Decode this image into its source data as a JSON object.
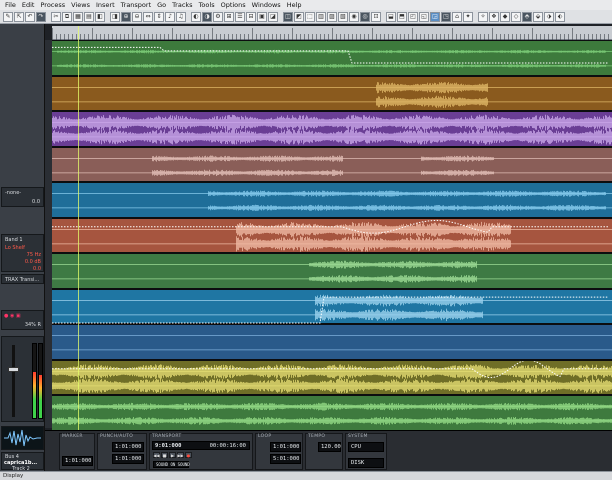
{
  "menu": {
    "items": [
      "File",
      "Edit",
      "Process",
      "Views",
      "Insert",
      "Transport",
      "Go",
      "Tracks",
      "Tools",
      "Options",
      "Windows",
      "Help"
    ]
  },
  "inspector": {
    "top_dropdown": "-none-",
    "top_value": "0.0",
    "band_label": "Band 1",
    "shelf_label": "Lo Shelf",
    "eq_freq": "75 Hz",
    "eq_gain": "0.0 dB",
    "eq_q": "0.0",
    "trans_label": "TRAX Transi...",
    "pan_value": "34% R",
    "bus_label": "Bus 4",
    "track_name": "caprica1b...",
    "track_number": "Track 2"
  },
  "tracks": [
    {
      "color": "#3d7a3c",
      "wave": "#7fd17c"
    },
    {
      "color": "#8a5a1e",
      "wave": "#e7bf6d"
    },
    {
      "color": "#6a3e95",
      "wave": "#d3b1f2"
    },
    {
      "color": "#8a5e58",
      "wave": "#e9c7bf"
    },
    {
      "color": "#1f6e99",
      "wave": "#8fd3f4"
    },
    {
      "color": "#a6553f",
      "wave": "#f7c4ae"
    },
    {
      "color": "#3e7a44",
      "wave": "#a5e39c"
    },
    {
      "color": "#1f76a3",
      "wave": "#a7dcf5"
    },
    {
      "color": "#2a5a8a",
      "wave": "#86b7e3"
    },
    {
      "color": "#6f6e27",
      "wave": "#eee77a"
    },
    {
      "color": "#3e7a3e",
      "wave": "#9be38d"
    }
  ],
  "bottom": {
    "groups": {
      "marker": "MARKER",
      "punch": "PUNCH/AUTO",
      "transport": "TRANSPORT",
      "loop": "LOOP",
      "tempo": "TEMPO",
      "system": "SYSTEM"
    },
    "marker_value": "1:01:000",
    "punch_in": "1:01:000",
    "punch_out": "1:01:000",
    "transport_now": "9:01:000",
    "transport_time": "00:00:16:00",
    "transport_mode": "SOUND ON SOUND",
    "loop_start": "1:01:000",
    "loop_end": "5:01:000",
    "tempo_value": "120.00",
    "system_cpu": "CPU",
    "system_disk": "DISK"
  },
  "statusbar": {
    "mode": "Display"
  }
}
